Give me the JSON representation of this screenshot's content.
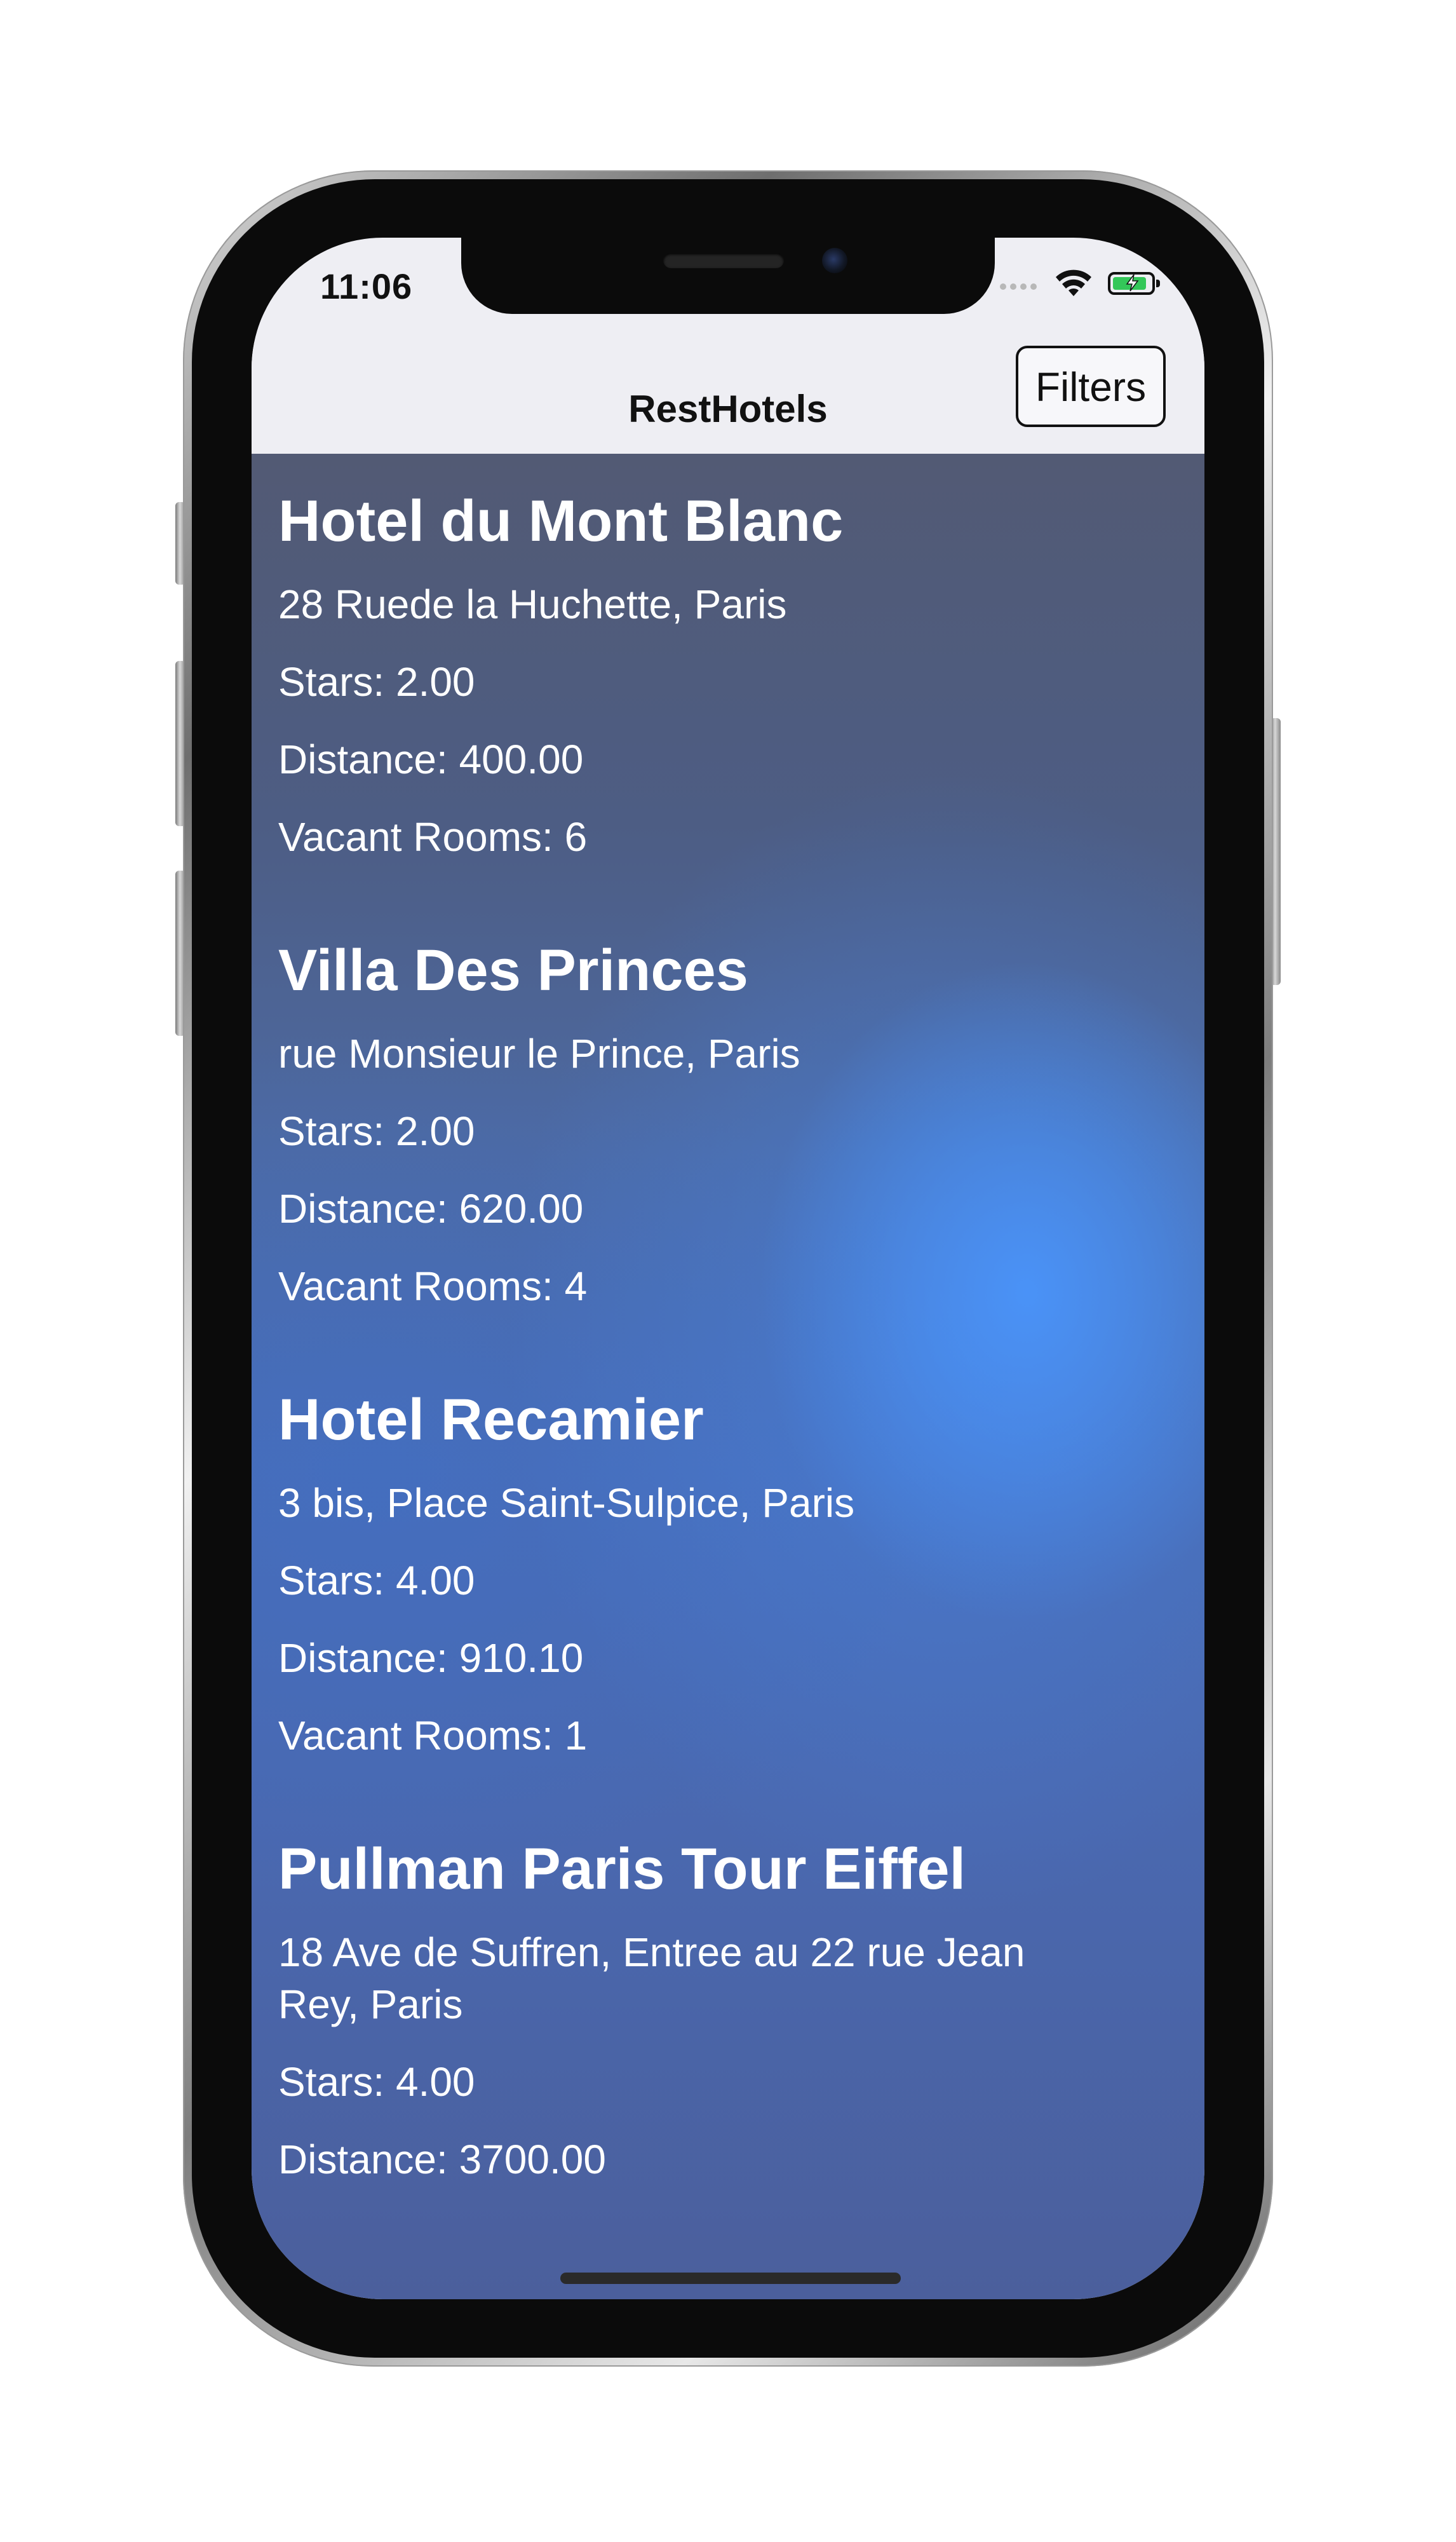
{
  "status_bar": {
    "time": "11:06",
    "wifi_icon": "wifi-icon",
    "battery_icon": "battery-charging-icon",
    "battery_color": "#34c759"
  },
  "navbar": {
    "title": "RestHotels",
    "filters_label": "Filters"
  },
  "hotels": [
    {
      "name": "Hotel du Mont Blanc",
      "address": "28 Ruede la Huchette, Paris",
      "stars": "Stars: 2.00",
      "distance": "Distance:  400.00",
      "vacant_rooms": "Vacant Rooms: 6"
    },
    {
      "name": "Villa Des Princes",
      "address": "rue Monsieur le Prince, Paris",
      "stars": "Stars: 2.00",
      "distance": "Distance:  620.00",
      "vacant_rooms": "Vacant Rooms: 4"
    },
    {
      "name": "Hotel Recamier",
      "address": "3 bis, Place Saint-Sulpice, Paris",
      "stars": "Stars: 4.00",
      "distance": "Distance:  910.10",
      "vacant_rooms": "Vacant Rooms: 1"
    },
    {
      "name": "Pullman Paris Tour Eiffel",
      "address_line1": "18 Ave de Suffren, Entree au 22 rue Jean",
      "address_line2": "Rey, Paris",
      "stars": "Stars: 4.00",
      "distance": "Distance:  3700.00"
    }
  ],
  "colors": {
    "content_text": "#ffffff",
    "nav_background": "#eeeef3",
    "accent_blue": "#4a94fa"
  }
}
